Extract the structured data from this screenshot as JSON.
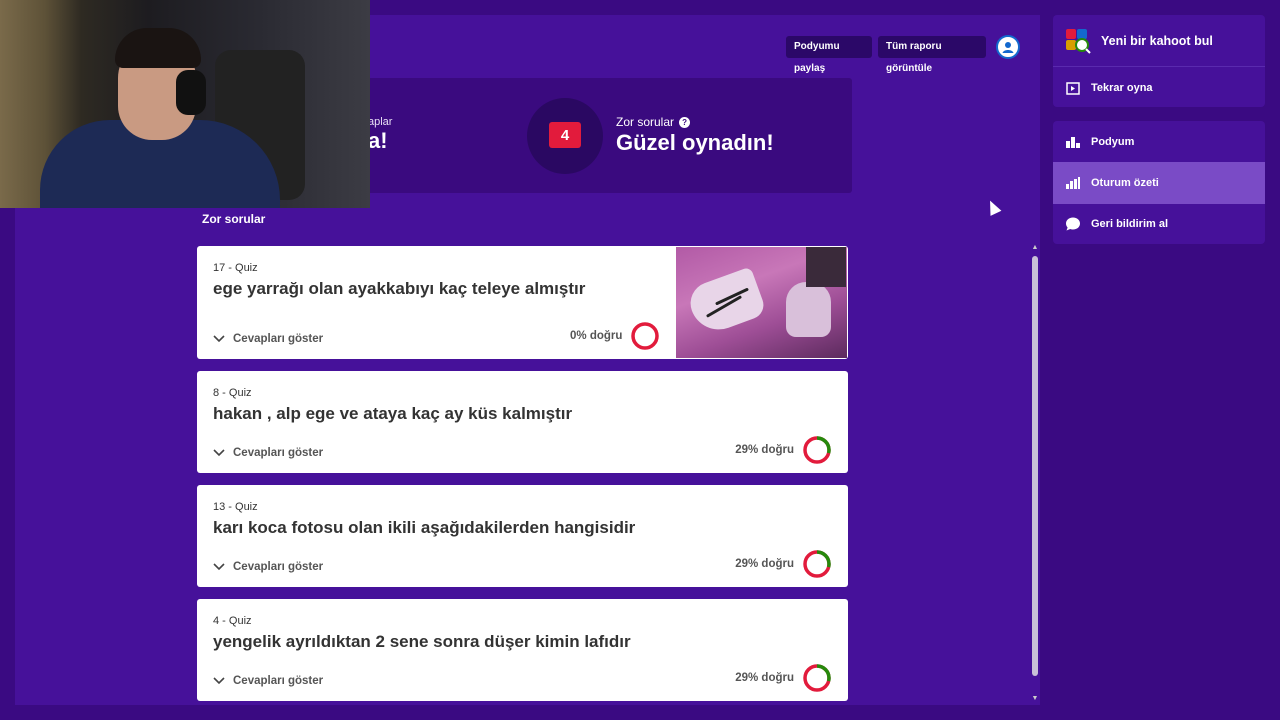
{
  "header": {
    "share_podium": "Podyumu paylaş",
    "full_report": "Tüm raporu görüntüle"
  },
  "summary": {
    "left_label_partial": "aplar",
    "left_title_partial": "a!",
    "hard_count": "4",
    "hard_label": "Zor sorular",
    "hard_title": "Güzel oynadın!"
  },
  "section_title": "Zor sorular",
  "questions": [
    {
      "meta": "17 - Quiz",
      "title": "ege yarrağı olan ayakkabıyı kaç teleye almıştır",
      "toggle": "Cevapları göster",
      "score": "0% doğru",
      "correct_ratio": 0.0
    },
    {
      "meta": "8 - Quiz",
      "title": "hakan , alp ege ve ataya kaç ay küs kalmıştır",
      "toggle": "Cevapları göster",
      "score": "29% doğru",
      "correct_ratio": 0.29
    },
    {
      "meta": "13 - Quiz",
      "title": "karı koca fotosu olan ikili aşağıdakilerden hangisidir",
      "toggle": "Cevapları göster",
      "score": "29% doğru",
      "correct_ratio": 0.29
    },
    {
      "meta": "4 - Quiz",
      "title": "yengelik ayrıldıktan 2 sene sonra düşer kimin lafıdır",
      "toggle": "Cevapları göster",
      "score": "29% doğru",
      "correct_ratio": 0.29
    }
  ],
  "sidebar": {
    "find_kahoot": "Yeni bir kahoot bul",
    "play_again": "Tekrar oyna",
    "podium": "Podyum",
    "session_summary": "Oturum özeti",
    "feedback": "Geri bildirim al"
  },
  "colors": {
    "correct": "#26890c",
    "incorrect": "#e21b3c"
  }
}
